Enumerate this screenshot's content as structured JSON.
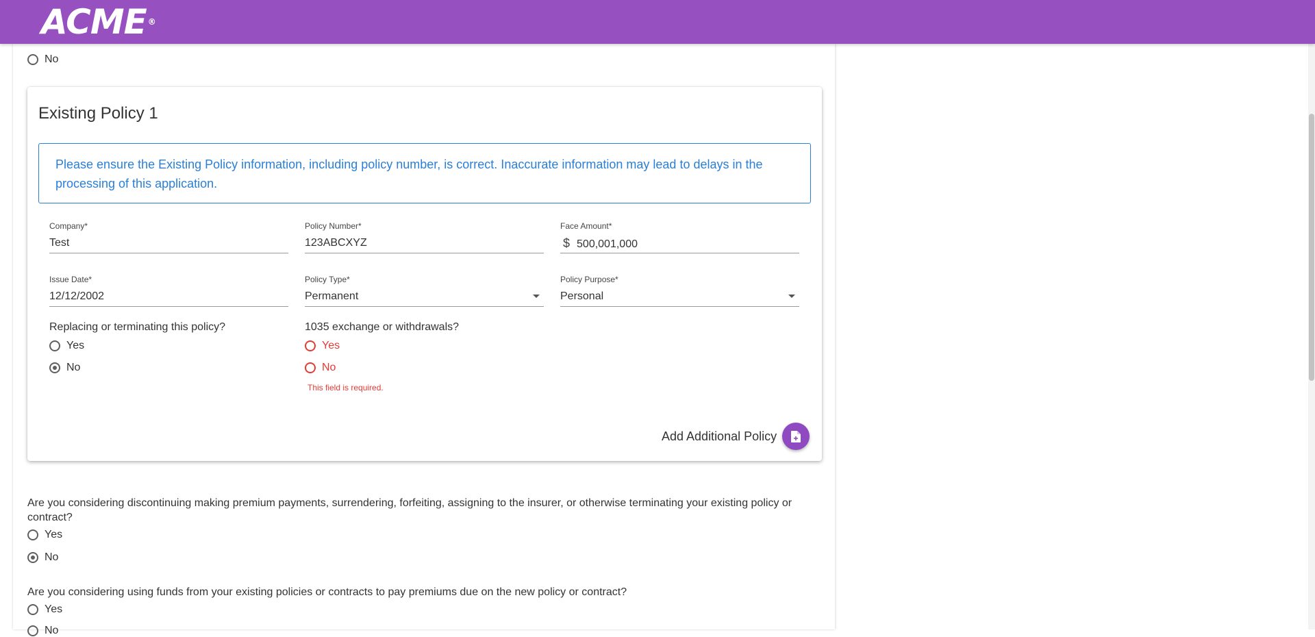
{
  "header": {
    "logo_text": "ACME",
    "logo_mark": "®"
  },
  "colors": {
    "brand": "#9650c0",
    "fab": "#8f49c1",
    "info": "#2a7fd4",
    "error": "#e53935"
  },
  "prev_question": {
    "no_label": "No"
  },
  "policy_card": {
    "title": "Existing Policy 1",
    "notice": "Please ensure the Existing Policy information, including policy number, is correct. Inaccurate information may lead to delays in the processing of this application.",
    "fields": {
      "company": {
        "label": "Company*",
        "value": "Test"
      },
      "policy_number": {
        "label": "Policy Number*",
        "value": "123ABCXYZ"
      },
      "face_amount": {
        "label": "Face Amount*",
        "currency": "$",
        "value": "500,001,000"
      },
      "issue_date": {
        "label": "Issue Date*",
        "value": "12/12/2002"
      },
      "policy_type": {
        "label": "Policy Type*",
        "value": "Permanent"
      },
      "policy_purpose": {
        "label": "Policy Purpose*",
        "value": "Personal"
      }
    },
    "replacing": {
      "label": "Replacing or terminating this policy?",
      "yes": "Yes",
      "no": "No",
      "selected": "No"
    },
    "exchange": {
      "label": "1035 exchange or withdrawals?",
      "yes": "Yes",
      "no": "No",
      "error": "This field is required."
    },
    "add_policy_label": "Add Additional Policy",
    "add_policy_icon": "note-add-icon"
  },
  "questions": [
    {
      "text": "Are you considering discontinuing making premium payments, surrendering, forfeiting, assigning to the insurer, or otherwise terminating your existing policy or contract?",
      "yes": "Yes",
      "no": "No",
      "selected": "No"
    },
    {
      "text": "Are you considering using funds from your existing policies or contracts to pay premiums due on the new policy or contract?",
      "yes": "Yes",
      "no": "No"
    }
  ]
}
